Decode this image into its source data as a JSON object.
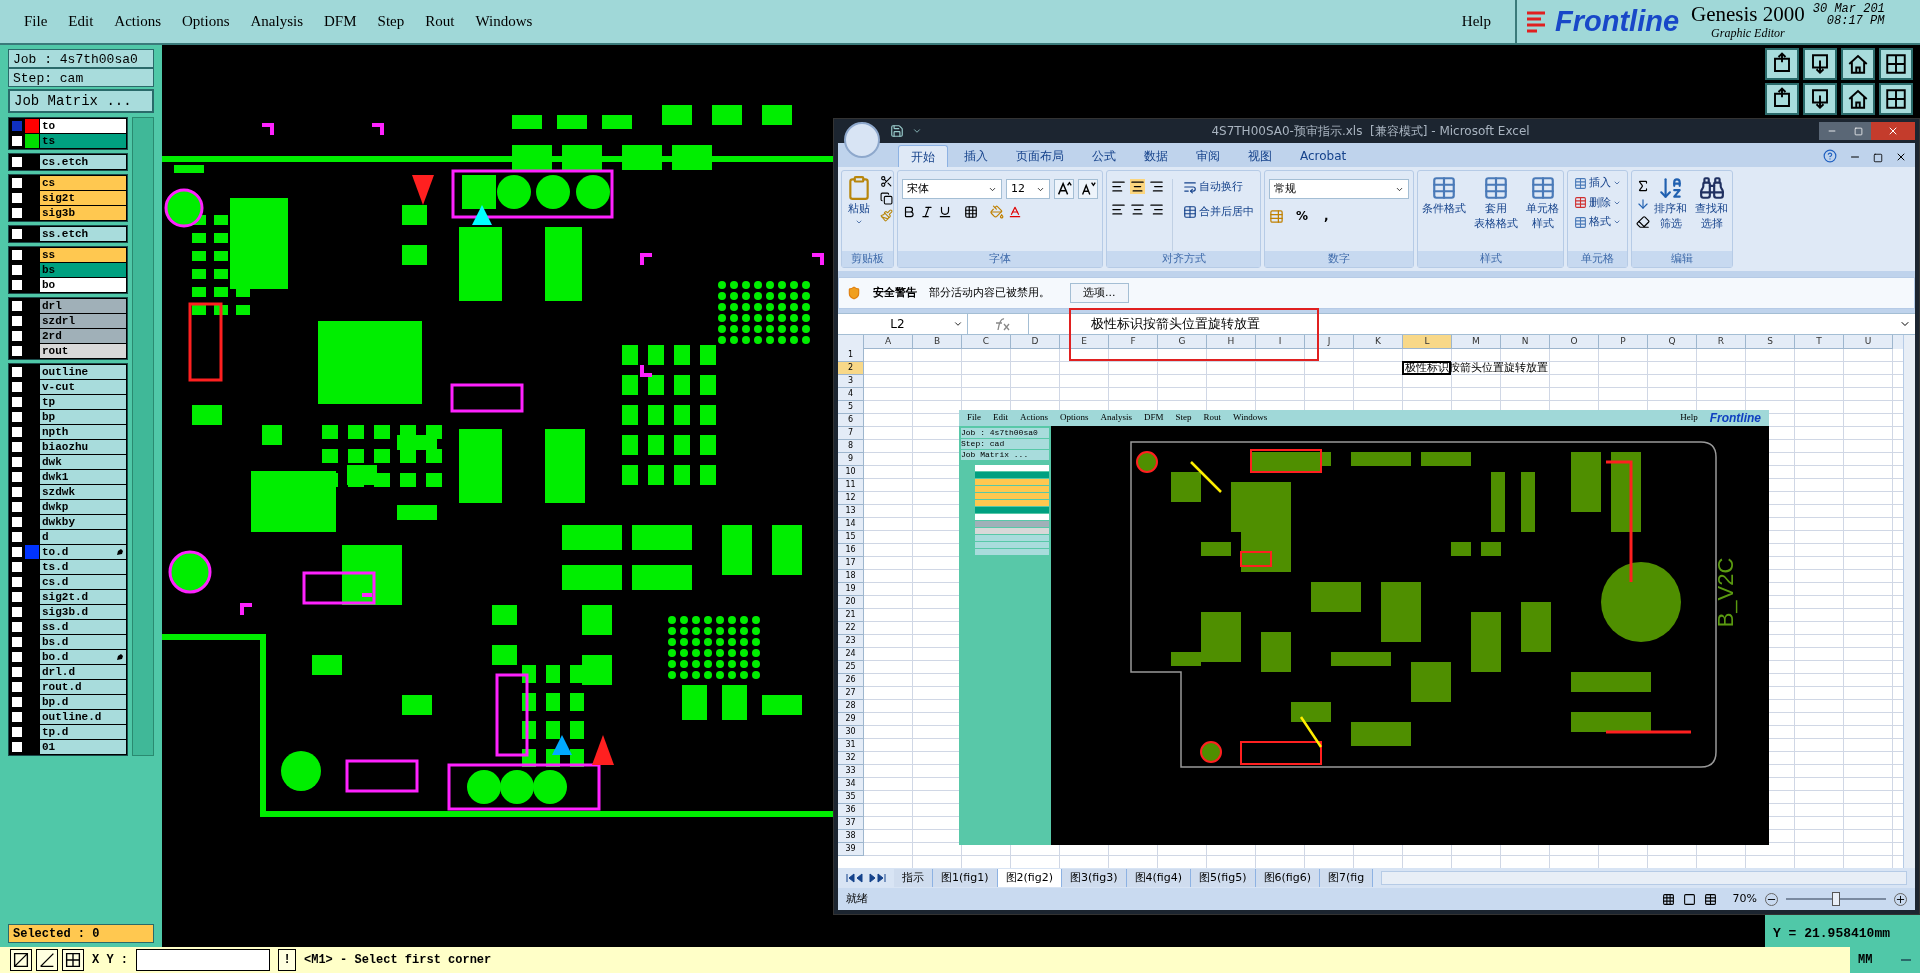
{
  "menu_bar": {
    "items": [
      "File",
      "Edit",
      "Actions",
      "Options",
      "Analysis",
      "DFM",
      "Step",
      "Rout",
      "Windows"
    ],
    "help": "Help"
  },
  "brand": {
    "logo": "Frontline",
    "product": "Genesis 2000",
    "date": "30 Mar 201",
    "time": "08:17 PM",
    "subtitle": "Graphic Editor"
  },
  "job_panel": {
    "job": "Job : 4s7th00sa0",
    "step": "Step: cam",
    "matrix_button": "Job Matrix ...",
    "selected_count": "Selected : 0",
    "layer_groups": [
      [
        {
          "name": "to",
          "color": "#ffffff",
          "swatch": {
            "color": "#ff0000"
          },
          "selected": true,
          "flag": false
        },
        {
          "name": "ts",
          "color": "#00a080",
          "swatch": {
            "color": "#00dd00"
          },
          "selected": false,
          "flag": false
        }
      ],
      [
        {
          "name": "cs.etch",
          "color": "#a8dcdc",
          "selected": false,
          "flag": false
        }
      ],
      [
        {
          "name": "cs",
          "color": "#ffc850",
          "selected": false,
          "flag": false
        },
        {
          "name": "sig2t",
          "color": "#ffc850",
          "selected": false,
          "flag": false
        },
        {
          "name": "sig3b",
          "color": "#ffc850",
          "selected": false,
          "flag": false
        }
      ],
      [
        {
          "name": "ss.etch",
          "color": "#a8dcdc",
          "selected": false,
          "flag": false
        }
      ],
      [
        {
          "name": "ss",
          "color": "#ffc850",
          "selected": false,
          "flag": false
        },
        {
          "name": "bs",
          "color": "#00a080",
          "selected": false,
          "flag": false
        },
        {
          "name": "bo",
          "color": "#ffffff",
          "selected": false,
          "flag": false
        }
      ],
      [
        {
          "name": "drl",
          "color": "#a0b0b8",
          "selected": false,
          "flag": false
        },
        {
          "name": "szdrl",
          "color": "#a0b0b8",
          "selected": false,
          "flag": false
        },
        {
          "name": "2rd",
          "color": "#a0b0b8",
          "selected": false,
          "flag": false
        },
        {
          "name": "rout",
          "color": "#d8d8d8",
          "selected": false,
          "flag": false
        }
      ],
      [
        {
          "name": "outline",
          "color": "#a8dcdc",
          "selected": false,
          "flag": false
        },
        {
          "name": "v-cut",
          "color": "#a8dcdc",
          "selected": false,
          "flag": false
        },
        {
          "name": "tp",
          "color": "#a8dcdc",
          "selected": false,
          "flag": false
        },
        {
          "name": "bp",
          "color": "#a8dcdc",
          "selected": false,
          "flag": false
        },
        {
          "name": "npth",
          "color": "#a8dcdc",
          "selected": false,
          "flag": false
        },
        {
          "name": "biaozhu",
          "color": "#a8dcdc",
          "selected": false,
          "flag": false
        },
        {
          "name": "dwk",
          "color": "#a8dcdc",
          "selected": false,
          "flag": false
        },
        {
          "name": "dwk1",
          "color": "#a8dcdc",
          "selected": false,
          "flag": false
        },
        {
          "name": "szdwk",
          "color": "#a8dcdc",
          "selected": false,
          "flag": false
        },
        {
          "name": "dwkp",
          "color": "#a8dcdc",
          "selected": false,
          "flag": false
        },
        {
          "name": "dwkby",
          "color": "#a8dcdc",
          "selected": false,
          "flag": false
        },
        {
          "name": "d",
          "color": "#a8dcdc",
          "selected": false,
          "flag": false
        },
        {
          "name": "to.d",
          "color": "#a8dcdc",
          "swatch": {
            "color": "#0033ff"
          },
          "selected": false,
          "flag": true
        },
        {
          "name": "ts.d",
          "color": "#a8dcdc",
          "selected": false,
          "flag": false
        },
        {
          "name": "cs.d",
          "color": "#a8dcdc",
          "selected": false,
          "flag": false
        },
        {
          "name": "sig2t.d",
          "color": "#a8dcdc",
          "selected": false,
          "flag": false
        },
        {
          "name": "sig3b.d",
          "color": "#a8dcdc",
          "selected": false,
          "flag": false
        },
        {
          "name": "ss.d",
          "color": "#a8dcdc",
          "selected": false,
          "flag": false
        },
        {
          "name": "bs.d",
          "color": "#a8dcdc",
          "selected": false,
          "flag": false
        },
        {
          "name": "bo.d",
          "color": "#a8dcdc",
          "selected": false,
          "flag": true
        },
        {
          "name": "drl.d",
          "color": "#a8dcdc",
          "selected": false,
          "flag": false
        },
        {
          "name": "rout.d",
          "color": "#a8dcdc",
          "selected": false,
          "flag": false
        },
        {
          "name": "bp.d",
          "color": "#a8dcdc",
          "selected": false,
          "flag": false
        },
        {
          "name": "outline.d",
          "color": "#a8dcdc",
          "selected": false,
          "flag": false
        },
        {
          "name": "tp.d",
          "color": "#a8dcdc",
          "selected": false,
          "flag": false
        },
        {
          "name": "01",
          "color": "#a8dcdc",
          "selected": false,
          "flag": false
        }
      ]
    ]
  },
  "excel": {
    "title": "4S7TH00SA0-预审指示.xls  [兼容模式] - Microsoft Excel",
    "tabs": [
      {
        "label": "开始",
        "selected": true
      },
      {
        "label": "插入",
        "selected": false
      },
      {
        "label": "页面布局",
        "selected": false
      },
      {
        "label": "公式",
        "selected": false
      },
      {
        "label": "数据",
        "selected": false
      },
      {
        "label": "审阅",
        "selected": false
      },
      {
        "label": "视图",
        "selected": false
      },
      {
        "label": "Acrobat",
        "selected": false
      }
    ],
    "ribbon": [
      {
        "kind": "clipboard",
        "name": "剪贴板",
        "buttons": [
          {
            "lines": [
              "粘贴"
            ]
          }
        ]
      },
      {
        "kind": "font",
        "name": "字体",
        "font": "宋体",
        "size": "12"
      },
      {
        "kind": "align",
        "name": "对齐方式",
        "buttons": [
          {
            "lines": [
              "自动换行"
            ]
          },
          {
            "lines": [
              "合并后居中"
            ]
          }
        ]
      },
      {
        "kind": "number",
        "name": "数字",
        "format": "常规",
        "symbols": [
          "%",
          ","
        ]
      },
      {
        "kind": "styles",
        "name": "样式",
        "buttons": [
          {
            "lines": [
              "条件格式"
            ]
          },
          {
            "lines": [
              "套用",
              "表格格式"
            ]
          },
          {
            "lines": [
              "单元格",
              "样式"
            ]
          }
        ]
      },
      {
        "kind": "cells",
        "name": "单元格",
        "buttons": [
          {
            "lines": [
              "插入"
            ]
          },
          {
            "lines": [
              "删除"
            ]
          },
          {
            "lines": [
              "格式"
            ]
          }
        ]
      },
      {
        "kind": "editing",
        "name": "编辑",
        "buttons": [
          {
            "lines": [
              "排序和",
              "筛选"
            ]
          },
          {
            "lines": [
              "查找和",
              "选择"
            ]
          }
        ]
      }
    ],
    "security": {
      "title": "安全警告",
      "message": "部分活动内容已被禁用。",
      "button": "选项..."
    },
    "name_box": "L2",
    "formula": "极性标识按箭头位置旋转放置",
    "active_cell": "极性标识按箭头位置旋转放置",
    "columns": [
      {
        "label": "A",
        "selected": false
      },
      {
        "label": "B",
        "selected": false
      },
      {
        "label": "C",
        "selected": false
      },
      {
        "label": "D",
        "selected": false
      },
      {
        "label": "E",
        "selected": false
      },
      {
        "label": "F",
        "selected": false
      },
      {
        "label": "G",
        "selected": false
      },
      {
        "label": "H",
        "selected": false
      },
      {
        "label": "I",
        "selected": false
      },
      {
        "label": "J",
        "selected": false
      },
      {
        "label": "K",
        "selected": false
      },
      {
        "label": "L",
        "selected": true
      },
      {
        "label": "M",
        "selected": false
      },
      {
        "label": "N",
        "selected": false
      },
      {
        "label": "O",
        "selected": false
      },
      {
        "label": "P",
        "selected": false
      },
      {
        "label": "Q",
        "selected": false
      },
      {
        "label": "R",
        "selected": false
      },
      {
        "label": "S",
        "selected": false
      },
      {
        "label": "T",
        "selected": false
      },
      {
        "label": "U",
        "selected": false
      }
    ],
    "rows": [
      {
        "label": "1",
        "selected": false
      },
      {
        "label": "2",
        "selected": true
      },
      {
        "label": "3",
        "selected": false
      },
      {
        "label": "4",
        "selected": false
      },
      {
        "label": "5",
        "selected": false
      },
      {
        "label": "6",
        "selected": false
      },
      {
        "label": "7",
        "selected": false
      },
      {
        "label": "8",
        "selected": false
      },
      {
        "label": "9",
        "selected": false
      },
      {
        "label": "10",
        "selected": false
      },
      {
        "label": "11",
        "selected": false
      },
      {
        "label": "12",
        "selected": false
      },
      {
        "label": "13",
        "selected": false
      },
      {
        "label": "14",
        "selected": false
      },
      {
        "label": "15",
        "selected": false
      },
      {
        "label": "16",
        "selected": false
      },
      {
        "label": "17",
        "selected": false
      },
      {
        "label": "18",
        "selected": false
      },
      {
        "label": "19",
        "selected": false
      },
      {
        "label": "20",
        "selected": false
      },
      {
        "label": "21",
        "selected": false
      },
      {
        "label": "22",
        "selected": false
      },
      {
        "label": "23",
        "selected": false
      },
      {
        "label": "24",
        "selected": false
      },
      {
        "label": "25",
        "selected": false
      },
      {
        "label": "26",
        "selected": false
      },
      {
        "label": "27",
        "selected": false
      },
      {
        "label": "28",
        "selected": false
      },
      {
        "label": "29",
        "selected": false
      },
      {
        "label": "30",
        "selected": false
      },
      {
        "label": "31",
        "selected": false
      },
      {
        "label": "32",
        "selected": false
      },
      {
        "label": "33",
        "selected": false
      },
      {
        "label": "34",
        "selected": false
      },
      {
        "label": "35",
        "selected": false
      },
      {
        "label": "36",
        "selected": false
      },
      {
        "label": "37",
        "selected": false
      },
      {
        "label": "38",
        "selected": false
      },
      {
        "label": "39",
        "selected": false
      }
    ],
    "embedded_screen": {
      "menu": [
        "File",
        "Edit",
        "Actions",
        "Options",
        "Analysis",
        "DFM",
        "Step",
        "Rout",
        "Windows"
      ],
      "help": "Help",
      "logo": "Frontline",
      "job": "Job : 4s7th00sa0",
      "step": "Step: cad",
      "matrix": "Job Matrix ...",
      "board_label": "B_V2C"
    },
    "sheet_tabs": [
      {
        "label": "指示",
        "selected": false
      },
      {
        "label": "图1(fig1)",
        "selected": false
      },
      {
        "label": "图2(fig2)",
        "selected": true
      },
      {
        "label": "图3(fig3)",
        "selected": false
      },
      {
        "label": "图4(fig4)",
        "selected": false
      },
      {
        "label": "图5(fig5)",
        "selected": false
      },
      {
        "label": "图6(fig6)",
        "selected": false
      },
      {
        "label": "图7(fig",
        "selected": false
      }
    ],
    "status": "就绪",
    "zoom": "70%",
    "zoom_slider": {
      "level": 0.5
    }
  },
  "coordinates": {
    "y": "Y = 21.958410mm"
  },
  "status_bar": {
    "xy_label": "X Y :",
    "bang": "!",
    "prompt": "<M1> - Select first corner",
    "units": "MM"
  }
}
